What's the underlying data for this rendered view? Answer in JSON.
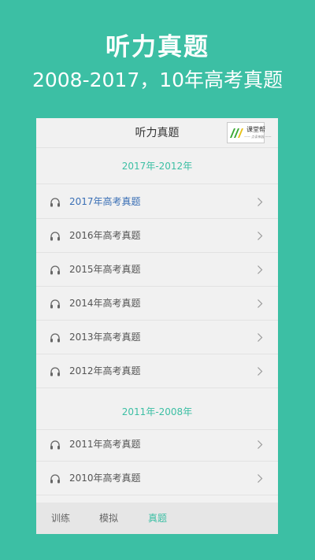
{
  "promo": {
    "title": "听力真题",
    "subtitle": "2008-2017，10年高考真题"
  },
  "header": {
    "title": "听力真题",
    "logo_text": "课堂帮",
    "logo_subtext": "—— 点读神器 ——"
  },
  "sections": [
    {
      "title": "2017年-2012年",
      "items": [
        {
          "label": "2017年高考真题",
          "active": true
        },
        {
          "label": "2016年高考真题",
          "active": false
        },
        {
          "label": "2015年高考真题",
          "active": false
        },
        {
          "label": "2014年高考真题",
          "active": false
        },
        {
          "label": "2013年高考真题",
          "active": false
        },
        {
          "label": "2012年高考真题",
          "active": false
        }
      ]
    },
    {
      "title": "2011年-2008年",
      "items": [
        {
          "label": "2011年高考真题",
          "active": false
        },
        {
          "label": "2010年高考真题",
          "active": false
        }
      ]
    }
  ],
  "tabs": [
    {
      "label": "训练",
      "active": false
    },
    {
      "label": "模拟",
      "active": false
    },
    {
      "label": "真题",
      "active": true
    }
  ],
  "icons": {
    "row_icon": "headphones-icon",
    "row_chevron": "chevron-right-icon",
    "logo": "logo-stripes-icon"
  },
  "colors": {
    "brand": "#3cbfa4",
    "active_item": "#3a6fb5",
    "logo_green": "#3aa832",
    "logo_yellow": "#e8c21a"
  }
}
